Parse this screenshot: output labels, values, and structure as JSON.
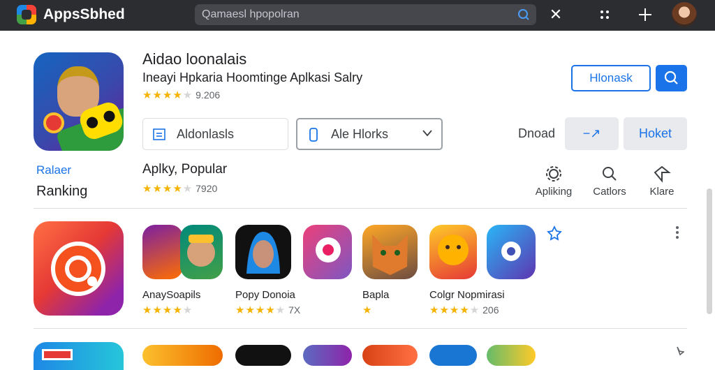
{
  "app": {
    "title": "AppsSbhed"
  },
  "search": {
    "placeholder": "Qamaesl hpopolran"
  },
  "featured": {
    "title": "Aidao loonalais",
    "subtitle": "Ineayi Hpkaria Hoomtinge Aplkasi Salry",
    "rating_stars": 4,
    "rating_text": "9.206",
    "button_outline": "Hlonask",
    "field_1": "Aldonlasls",
    "field_2": "Ale Hlorks",
    "label_right": "Dnoad",
    "pill_1": "−↗",
    "pill_2": "Hoket"
  },
  "sidebar": {
    "label_top": "Ralaer",
    "label_bottom": "Ranking"
  },
  "popular": {
    "title": "Aplky, Popular",
    "rating_stars": 4,
    "rating_text": "7920"
  },
  "actions": [
    {
      "label": "Apliking",
      "icon": "settings-icon"
    },
    {
      "label": "Catlors",
      "icon": "search-icon"
    },
    {
      "label": "Klare",
      "icon": "share-icon"
    }
  ],
  "apps_row1": [
    {
      "name": "AnaySoapils",
      "stars": 4,
      "extra": ""
    },
    {
      "name": "Popy Donoia",
      "stars": 4,
      "extra": "7X"
    },
    {
      "name": "Bapla",
      "stars": 1,
      "extra": ""
    },
    {
      "name": "Colgr Nopmirasi",
      "stars": 4,
      "extra": "206"
    }
  ],
  "colors": {
    "accent": "#1a73e8",
    "topbar": "#2b2d31",
    "star": "#f5b301"
  }
}
